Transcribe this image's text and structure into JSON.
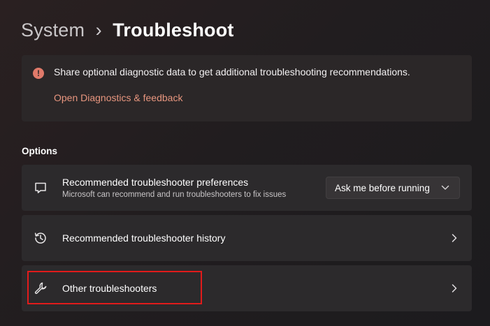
{
  "breadcrumb": {
    "parent": "System",
    "separator": "›",
    "current": "Troubleshoot"
  },
  "banner": {
    "icon": "info-icon",
    "icon_glyph": "!",
    "message": "Share optional diagnostic data to get additional troubleshooting recommendations.",
    "link": "Open Diagnostics & feedback"
  },
  "options": {
    "title": "Options",
    "items": [
      {
        "icon": "chat-bubble-icon",
        "title": "Recommended troubleshooter preferences",
        "subtitle": "Microsoft can recommend and run troubleshooters to fix issues",
        "dropdown_value": "Ask me before running"
      },
      {
        "icon": "history-icon",
        "title": "Recommended troubleshooter history"
      },
      {
        "icon": "wrench-icon",
        "title": "Other troubleshooters",
        "highlighted": true
      }
    ]
  },
  "colors": {
    "accent_link": "#e8967f",
    "highlight": "#e11b1b",
    "card_background": "#2c2a2c"
  }
}
